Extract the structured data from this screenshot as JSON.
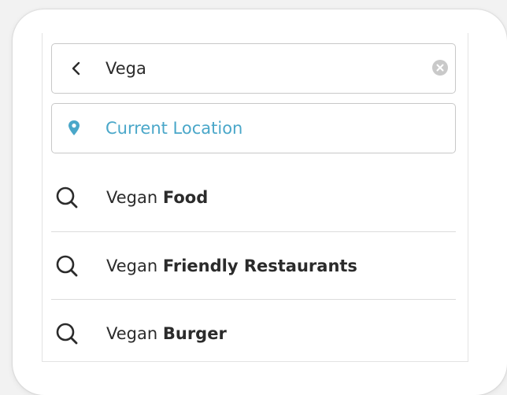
{
  "search": {
    "query": "Vega"
  },
  "location": {
    "label": "Current Location",
    "accent_color": "#4aa7c9"
  },
  "icons": {
    "back": "chevron-left-icon",
    "clear": "clear-circle-icon",
    "location": "map-pin-icon",
    "suggestion": "search-icon"
  },
  "suggestions": [
    {
      "prefix": "Vega",
      "match": "n ",
      "bold": "Food"
    },
    {
      "prefix": "Vega",
      "match": "n ",
      "bold": "Friendly Restaurants"
    },
    {
      "prefix": "Vega",
      "match": "n ",
      "bold": "Burger"
    }
  ]
}
